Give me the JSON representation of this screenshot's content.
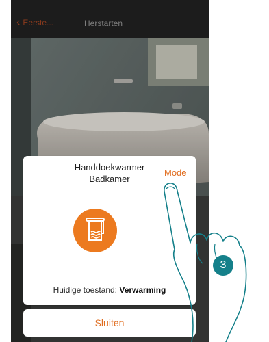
{
  "header": {
    "back_label": "Eerste...",
    "title": "Herstarten"
  },
  "card": {
    "device_name": "Handdoekwarmer",
    "room": "Badkamer",
    "mode_label": "Mode",
    "icon": "towel-warmer-icon",
    "status_label": "Huidige toestand:",
    "status_value": "Verwarming"
  },
  "close_label": "Sluiten",
  "step_number": "3",
  "colors": {
    "accent": "#e06b1c",
    "icon_bg": "#ec7a1f",
    "step_badge": "#15808a",
    "topbar": "#1c1c1c"
  }
}
